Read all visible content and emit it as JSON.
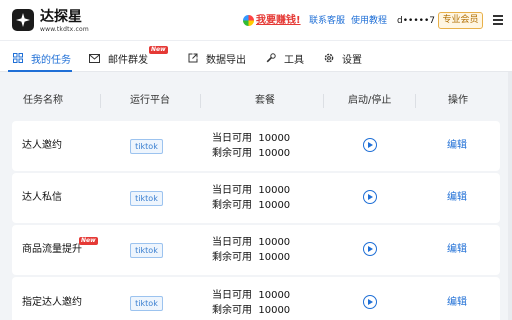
{
  "header": {
    "brand_name": "达探星",
    "brand_url": "www.tkdtx.com",
    "earn_label": "我要赚钱!",
    "contact_label": "联系客服",
    "tutorial_label": "使用教程",
    "user_name": "d•••••7",
    "vip_label": "专业会员",
    "menu_icon": "hamburger-icon"
  },
  "tabs": [
    {
      "label": "我的任务",
      "icon": "grid-icon",
      "active": true
    },
    {
      "label": "邮件群发",
      "icon": "mail-icon",
      "badge": "New"
    },
    {
      "label": "数据导出",
      "icon": "export-icon"
    },
    {
      "label": "工具",
      "icon": "wrench-icon"
    },
    {
      "label": "设置",
      "icon": "gear-icon"
    }
  ],
  "table": {
    "columns": [
      "任务名称",
      "运行平台",
      "套餐",
      "启动/停止",
      "操作"
    ],
    "rows": [
      {
        "name": "达人邀约",
        "platform": "tiktok",
        "today_label": "当日可用",
        "today_value": "10000",
        "remain_label": "剩余可用",
        "remain_value": "10000",
        "action": "编辑"
      },
      {
        "name": "达人私信",
        "platform": "tiktok",
        "today_label": "当日可用",
        "today_value": "10000",
        "remain_label": "剩余可用",
        "remain_value": "10000",
        "action": "编辑"
      },
      {
        "name": "商品流量提升",
        "badge": "New",
        "platform": "tiktok",
        "today_label": "当日可用",
        "today_value": "10000",
        "remain_label": "剩余可用",
        "remain_value": "10000",
        "action": "编辑"
      },
      {
        "name": "指定达人邀约",
        "platform": "tiktok",
        "today_label": "当日可用",
        "today_value": "10000",
        "remain_label": "剩余可用",
        "remain_value": "10000",
        "action": "编辑"
      }
    ]
  },
  "colors": {
    "accent": "#1f6fd6",
    "alert": "#e53935",
    "vip": "#e8b04a"
  }
}
